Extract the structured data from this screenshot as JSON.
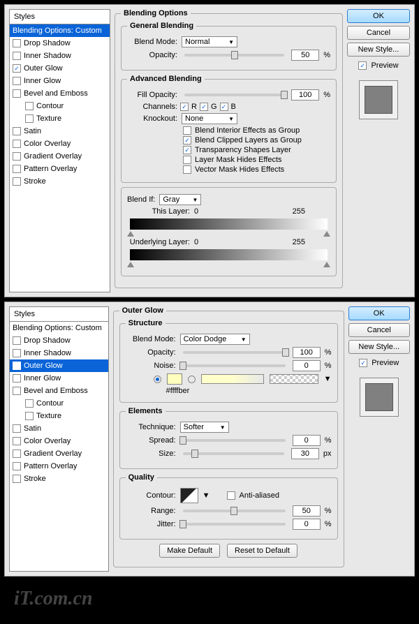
{
  "panels": {
    "styles_header": "Styles",
    "items": {
      "blending_options": "Blending Options: Custom",
      "drop_shadow": "Drop Shadow",
      "inner_shadow": "Inner Shadow",
      "outer_glow": "Outer Glow",
      "inner_glow": "Inner Glow",
      "bevel_emboss": "Bevel and Emboss",
      "contour": "Contour",
      "texture": "Texture",
      "satin": "Satin",
      "color_overlay": "Color Overlay",
      "gradient_overlay": "Gradient Overlay",
      "pattern_overlay": "Pattern Overlay",
      "stroke": "Stroke"
    }
  },
  "top": {
    "title": "Blending Options",
    "general": {
      "legend": "General Blending",
      "blend_mode_label": "Blend Mode:",
      "blend_mode_value": "Normal",
      "opacity_label": "Opacity:",
      "opacity_value": "50",
      "pct": "%"
    },
    "advanced": {
      "legend": "Advanced Blending",
      "fill_opacity_label": "Fill Opacity:",
      "fill_opacity_value": "100",
      "pct": "%",
      "channels_label": "Channels:",
      "ch_r": "R",
      "ch_g": "G",
      "ch_b": "B",
      "knockout_label": "Knockout:",
      "knockout_value": "None",
      "opt1": "Blend Interior Effects as Group",
      "opt2": "Blend Clipped Layers as Group",
      "opt3": "Transparency Shapes Layer",
      "opt4": "Layer Mask Hides Effects",
      "opt5": "Vector Mask Hides Effects"
    },
    "blendif": {
      "label": "Blend If:",
      "value": "Gray",
      "this_layer": "This Layer:",
      "underlying": "Underlying Layer:",
      "min": "0",
      "max": "255"
    }
  },
  "bottom": {
    "title": "Outer Glow",
    "structure": {
      "legend": "Structure",
      "blend_mode_label": "Blend Mode:",
      "blend_mode_value": "Color Dodge",
      "opacity_label": "Opacity:",
      "opacity_value": "100",
      "noise_label": "Noise:",
      "noise_value": "0",
      "pct": "%",
      "color_hex": "#ffffbe",
      "hex_typo_label": "#ffffber"
    },
    "elements": {
      "legend": "Elements",
      "technique_label": "Technique:",
      "technique_value": "Softer",
      "spread_label": "Spread:",
      "spread_value": "0",
      "pct": "%",
      "size_label": "Size:",
      "size_value": "30",
      "px": "px"
    },
    "quality": {
      "legend": "Quality",
      "contour_label": "Contour:",
      "anti_aliased": "Anti-aliased",
      "range_label": "Range:",
      "range_value": "50",
      "jitter_label": "Jitter:",
      "jitter_value": "0",
      "pct": "%"
    },
    "buttons": {
      "make_default": "Make Default",
      "reset_default": "Reset to Default"
    }
  },
  "side": {
    "ok": "OK",
    "cancel": "Cancel",
    "new_style": "New Style...",
    "preview": "Preview"
  },
  "watermark": "iT.com.cn"
}
